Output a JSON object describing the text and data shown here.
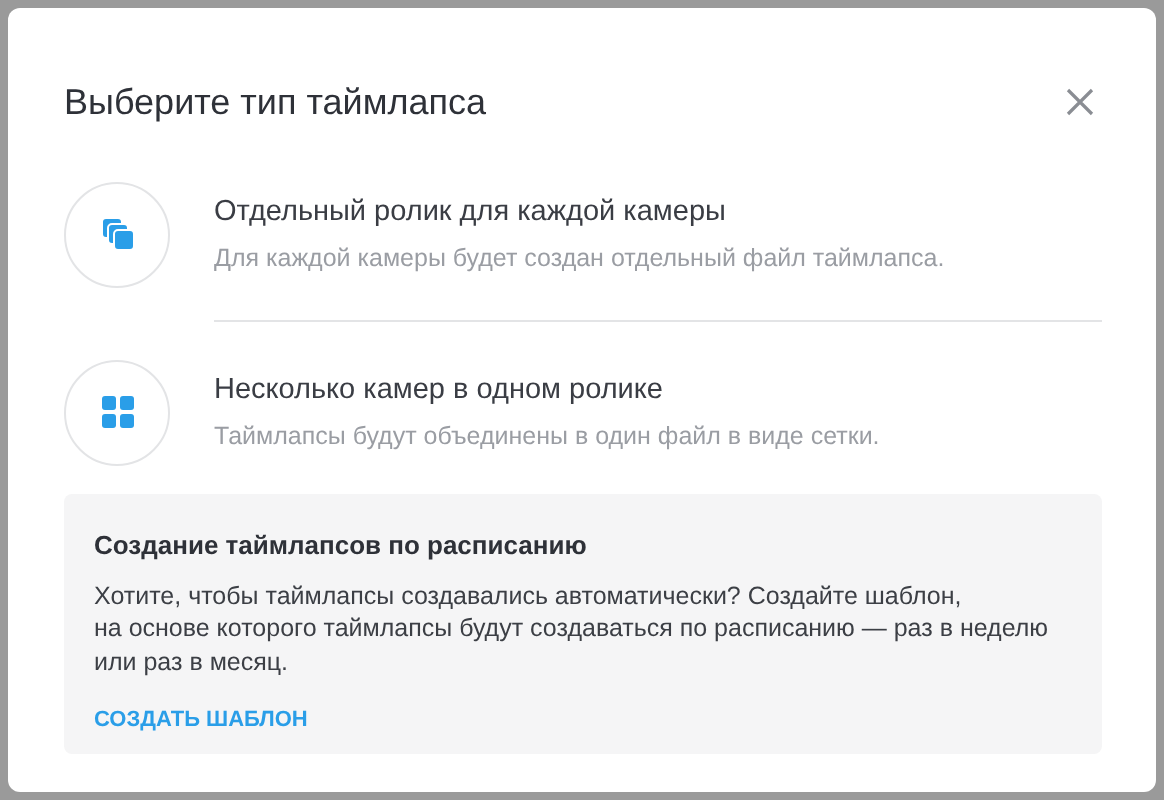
{
  "dialog": {
    "title": "Выберите тип таймлапса",
    "options": [
      {
        "kind": "stack",
        "title": "Отдельный ролик для каждой камеры",
        "description": "Для каждой камеры будет создан отдельный файл таймлапса."
      },
      {
        "kind": "grid",
        "title": "Несколько камер в одном ролике",
        "description": "Таймлапсы будут объединены в один файл в виде сетки."
      }
    ],
    "schedule": {
      "title": "Создание таймлапсов по расписанию",
      "text": "Хотите, чтобы таймлапсы создавались автоматически? Создайте шаблон,\nна основе которого таймлапсы будут создаваться по расписанию — раз в неделю или раз в месяц.",
      "link": "СОЗДАТЬ ШАБЛОН"
    }
  }
}
